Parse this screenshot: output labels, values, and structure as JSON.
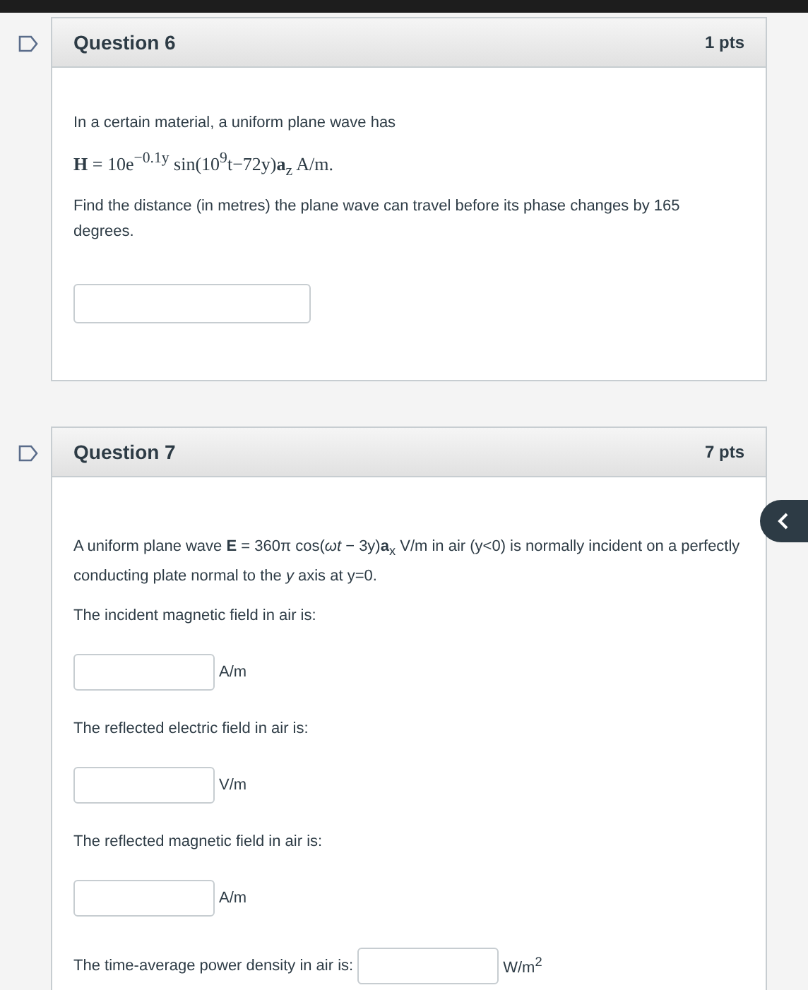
{
  "questions": [
    {
      "title": "Question 6",
      "points": "1 pts",
      "body": [
        {
          "kind": "text",
          "text": "In a certain material, a uniform plane wave has"
        },
        {
          "kind": "equation",
          "text": "**H** = 10e$^{−0.1y}$ sin(10$^{9}$t−72y)**a**$_{z}$ A/m."
        },
        {
          "kind": "text",
          "text": "Find the distance (in metres) the plane wave can travel before its phase changes by 165 degrees."
        },
        {
          "kind": "field"
        }
      ]
    },
    {
      "title": "Question 7",
      "points": "7 pts",
      "body": [
        {
          "kind": "text",
          "text": "A uniform plane wave **E** = 360π cos(*ωt* − 3y)**a**$_{x}$ V/m in air (y<0) is normally incident on a perfectly conducting plate normal to the *y* axis at y=0."
        },
        {
          "kind": "text",
          "text": "The incident magnetic field in air is:"
        },
        {
          "kind": "field",
          "unit": "A/m"
        },
        {
          "kind": "text",
          "text": "The reflected electric field in air is:"
        },
        {
          "kind": "field",
          "unit": "V/m"
        },
        {
          "kind": "text",
          "text": "The reflected magnetic field in air is:"
        },
        {
          "kind": "field",
          "unit": "A/m"
        },
        {
          "kind": "inline-field",
          "label": "The time-average power density in air is:",
          "unit": "W/m$^{2}$"
        }
      ]
    }
  ]
}
